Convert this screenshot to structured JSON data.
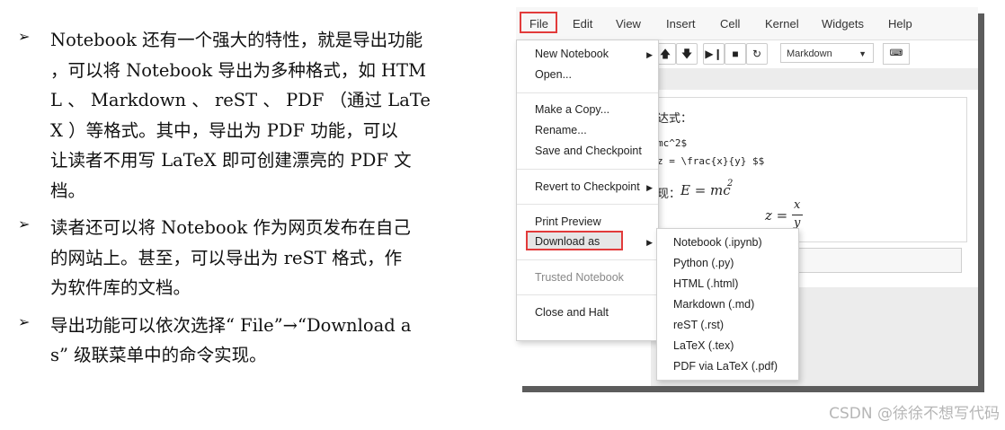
{
  "bullets": [
    {
      "lines": [
        "Notebook 还有一个强大的特性，就是导出功能",
        "，可以将 Notebook 导出为多种格式，如 HTM",
        "L 、 Markdown 、 reST 、 PDF （通过 LaTe",
        "X ）等格式。其中，导出为 PDF 功能，可以",
        "让读者不用写 LaTeX 即可创建漂亮的 PDF 文",
        "档。"
      ]
    },
    {
      "lines": [
        "读者还可以将 Notebook 作为网页发布在自己",
        "的网站上。甚至，可以导出为 reST 格式，作",
        "为软件库的文档。"
      ]
    },
    {
      "lines": [
        "导出功能可以依次选择“ File”→“Download a",
        "s” 级联菜单中的命令实现。"
      ]
    }
  ],
  "bullet_marker": "➢",
  "menubar": {
    "items": [
      "File",
      "Edit",
      "View",
      "Insert",
      "Cell",
      "Kernel",
      "Widgets",
      "Help"
    ]
  },
  "toolbar": {
    "cell_type": "Markdown"
  },
  "cell": {
    "line1": "达式：",
    "line2": "mc^2$",
    "line3": "z = \\frac{x}{y} $$",
    "line4": "现：",
    "line4_math": "E = mc",
    "sup": "2",
    "eq_left": "z =",
    "frac_num": "x",
    "frac_den": "y"
  },
  "file_menu": {
    "items": [
      "New Notebook",
      "Open...",
      "Make a Copy...",
      "Rename...",
      "Save and Checkpoint",
      "Revert to Checkpoint",
      "Print Preview",
      "Download as",
      "Trusted Notebook",
      "Close and Halt"
    ]
  },
  "download_menu": {
    "items": [
      "Notebook (.ipynb)",
      "Python (.py)",
      "HTML (.html)",
      "Markdown (.md)",
      "reST (.rst)",
      "LaTeX (.tex)",
      "PDF via LaTeX (.pdf)"
    ]
  },
  "watermark": "CSDN @徐徐不想写代码",
  "colors": {
    "highlight_border": "#e23b3b",
    "shadow": "#5c5c5c"
  }
}
